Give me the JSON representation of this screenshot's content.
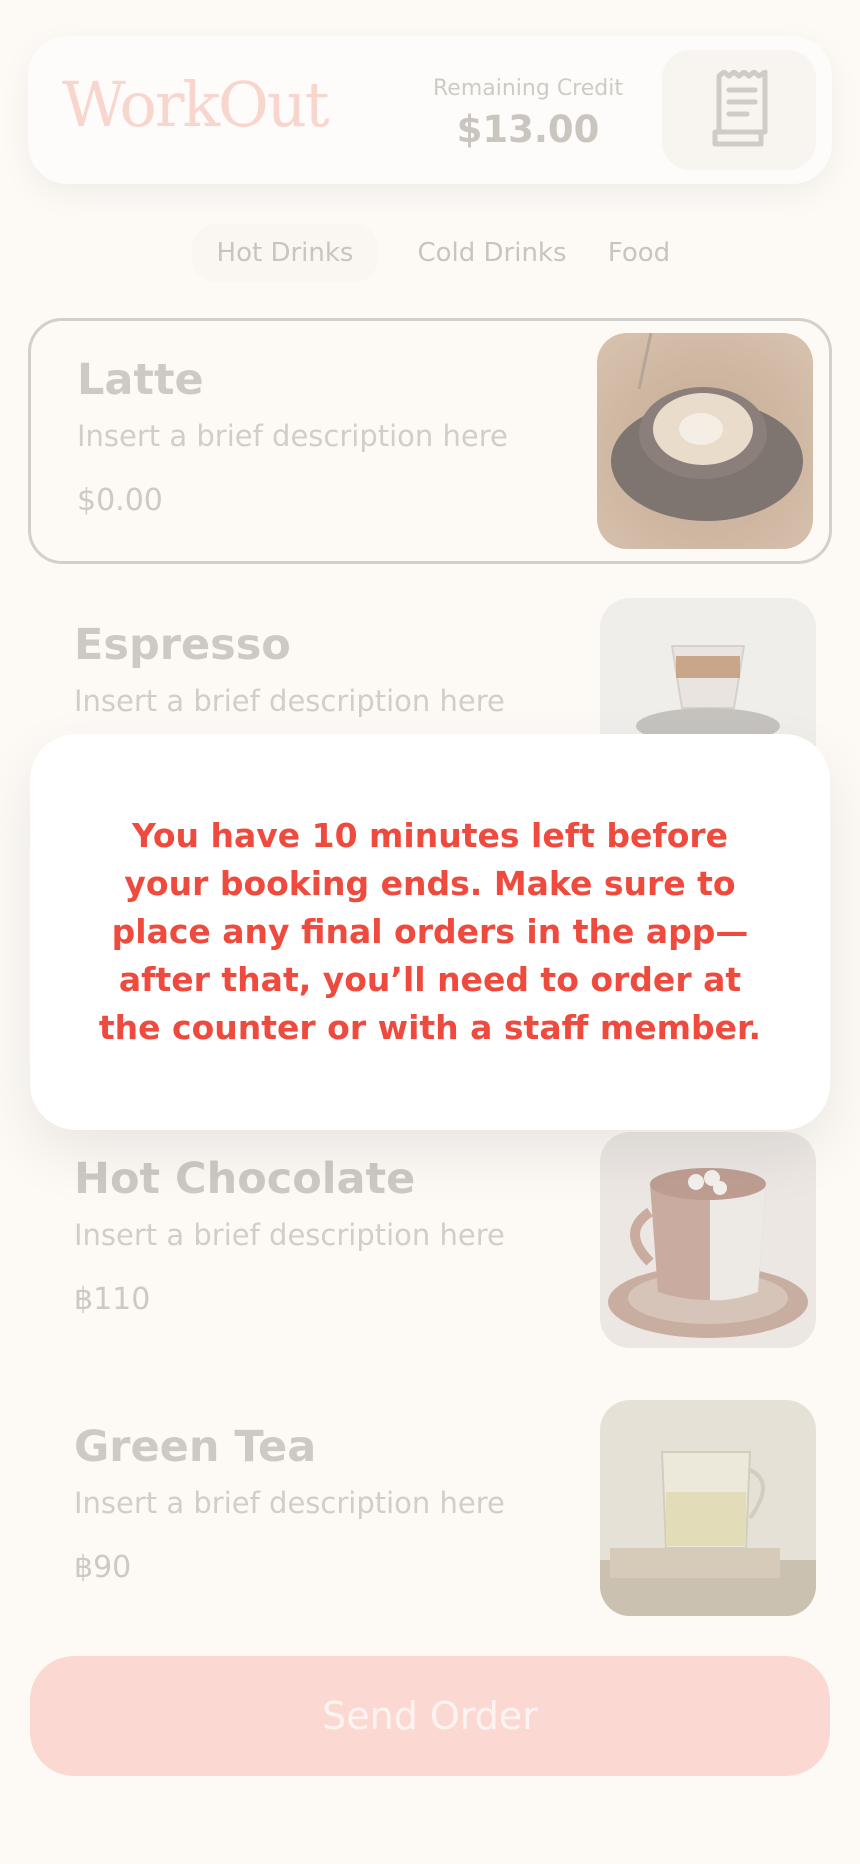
{
  "header": {
    "brand": "WorkOut",
    "credit_label": "Remaining Credit",
    "credit_value": "$13.00",
    "receipt_icon": "receipt-icon"
  },
  "tabs": [
    {
      "label": "Hot Drinks",
      "active": true
    },
    {
      "label": "Cold Drinks",
      "active": false
    },
    {
      "label": "Food",
      "active": false
    }
  ],
  "menu": [
    {
      "name": "Latte",
      "description": "Insert a brief description here",
      "price": "$0.00",
      "image": "latte-photo"
    },
    {
      "name": "Espresso",
      "description": "Insert a brief description here",
      "price": "",
      "image": "espresso-photo"
    },
    {
      "name": "Hot Chocolate",
      "description": "Insert a brief description here",
      "price": "฿110",
      "image": "hot-chocolate-photo"
    },
    {
      "name": "Green Tea",
      "description": "Insert a brief description here",
      "price": "฿90",
      "image": "green-tea-photo"
    }
  ],
  "modal": {
    "message": "You have 10 minutes left before your booking ends. Make sure to place any final orders in the app—after that, you’ll need to order at the counter or with a staff member."
  },
  "actions": {
    "send_order": "Send Order"
  },
  "colors": {
    "background": "#fdfaf6",
    "alert_text": "#ee4a3d",
    "brand": "#f8d5cd",
    "send_button": "#fbd9d2"
  }
}
